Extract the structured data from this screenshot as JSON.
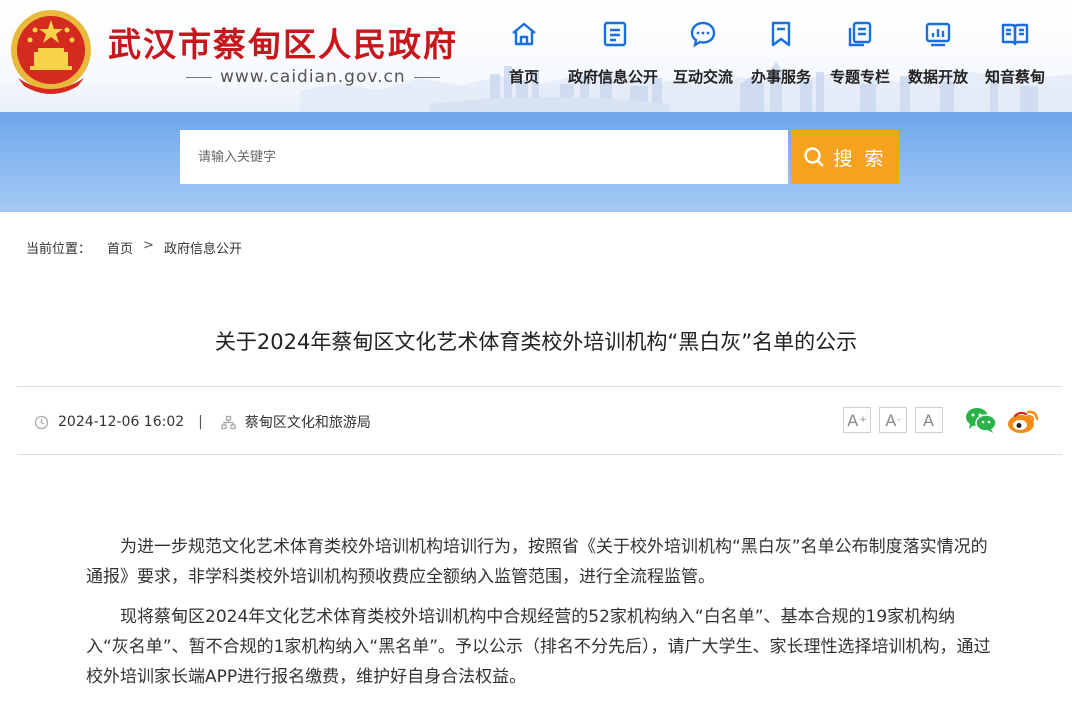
{
  "header": {
    "site_title": "武汉市蔡甸区人民政府",
    "site_url": "www.caidian.gov.cn",
    "nav": [
      {
        "label": "首页",
        "icon": "home-icon"
      },
      {
        "label": "政府信息公开",
        "icon": "document-list-icon",
        "active": true
      },
      {
        "label": "互动交流",
        "icon": "chat-bubble-icon"
      },
      {
        "label": "办事服务",
        "icon": "bookmark-icon"
      },
      {
        "label": "专题专栏",
        "icon": "copy-pages-icon"
      },
      {
        "label": "数据开放",
        "icon": "bar-chart-icon"
      },
      {
        "label": "知音蔡甸",
        "icon": "open-book-icon"
      }
    ]
  },
  "search": {
    "placeholder": "请输入关键字",
    "button_label": "搜 索"
  },
  "breadcrumb": {
    "label": "当前位置：",
    "items": [
      "首页",
      "政府信息公开"
    ],
    "separator": ">"
  },
  "article": {
    "title": "关于2024年蔡甸区文化艺术体育类校外培训机构“黑白灰”名单的公示",
    "date": "2024-12-06 16:02",
    "meta_separator": "|",
    "source": "蔡甸区文化和旅游局",
    "font_sizes": [
      {
        "glyph": "A",
        "mark": "+"
      },
      {
        "glyph": "A",
        "mark": "-"
      },
      {
        "glyph": "A",
        "mark": ""
      }
    ],
    "paragraphs": [
      "为进一步规范文化艺术体育类校外培训机构培训行为，按照省《关于校外培训机构“黑白灰”名单公布制度落实情况的通报》要求，非学科类校外培训机构预收费应全额纳入监管范围，进行全流程监管。",
      "现将蔡甸区2024年文化艺术体育类校外培训机构中合规经营的52家机构纳入“白名单”、基本合规的19家机构纳入“灰名单”、暂不合规的1家机构纳入“黑名单”。予以公示（排名不分先后），请广大学生、家长理性选择培训机构，通过校外培训家长端APP进行报名缴费，维护好自身合法权益。"
    ]
  },
  "colors": {
    "title_red": "#c8161d",
    "nav_blue": "#1a5fd0",
    "search_orange": "#f5a21c",
    "band_blue": "#7fb1ee",
    "wechat_green": "#29b34a",
    "weibo_orange": "#f08c1a"
  }
}
